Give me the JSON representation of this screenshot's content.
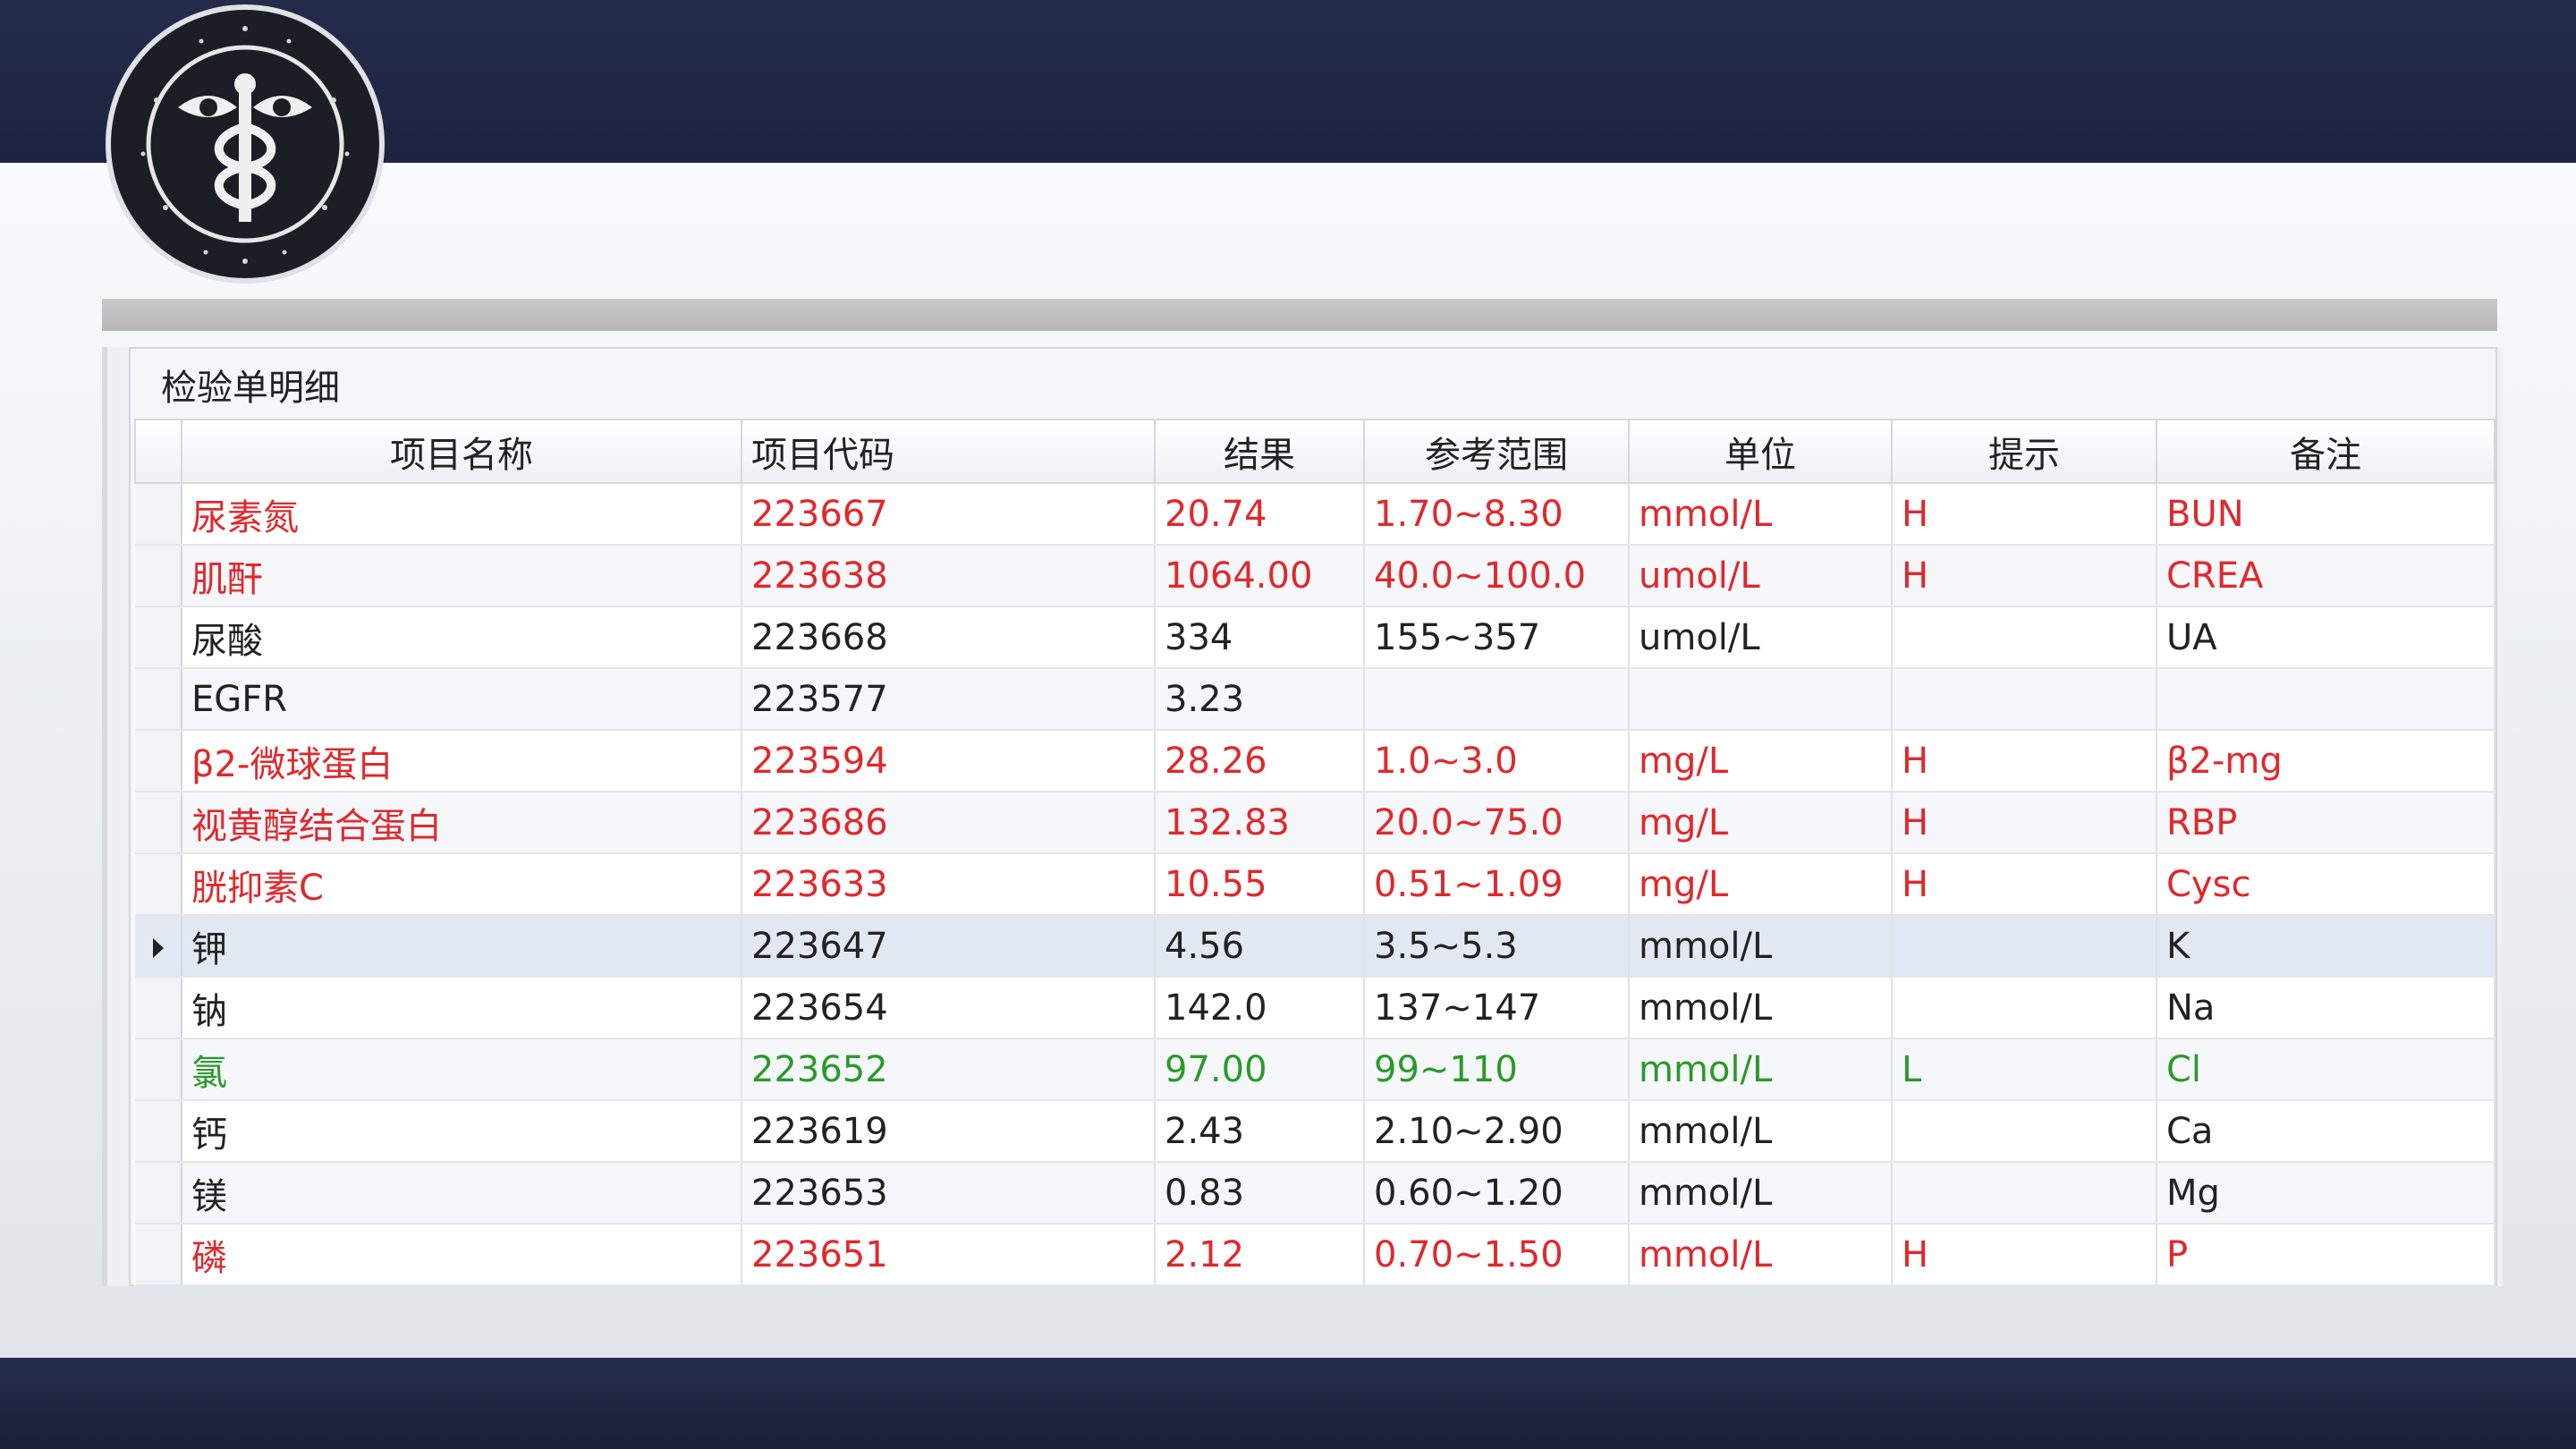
{
  "panel": {
    "title": "检验单明细"
  },
  "table": {
    "columns": [
      "项目名称",
      "项目代码",
      "结果",
      "参考范围",
      "单位",
      "提示",
      "备注"
    ],
    "rows": [
      {
        "name": "尿素氮",
        "code": "223667",
        "result": "20.74",
        "range": "1.70~8.30",
        "unit": "mmol/L",
        "flag": "H",
        "note": "BUN",
        "status": "high",
        "color": "#e0282c"
      },
      {
        "name": "肌酐",
        "code": "223638",
        "result": "1064.00",
        "range": "40.0~100.0",
        "unit": "umol/L",
        "flag": "H",
        "note": "CREA",
        "status": "high",
        "color": "#e0282c"
      },
      {
        "name": "尿酸",
        "code": "223668",
        "result": "334",
        "range": "155~357",
        "unit": "umol/L",
        "flag": "",
        "note": "UA",
        "status": "normal",
        "color": "#222222"
      },
      {
        "name": "EGFR",
        "code": "223577",
        "result": "3.23",
        "range": "",
        "unit": "",
        "flag": "",
        "note": "",
        "status": "normal",
        "color": "#222222"
      },
      {
        "name": "β2-微球蛋白",
        "code": "223594",
        "result": "28.26",
        "range": "1.0~3.0",
        "unit": "mg/L",
        "flag": "H",
        "note": "β2-mg",
        "status": "high",
        "color": "#e0282c"
      },
      {
        "name": "视黄醇结合蛋白",
        "code": "223686",
        "result": "132.83",
        "range": "20.0~75.0",
        "unit": "mg/L",
        "flag": "H",
        "note": "RBP",
        "status": "high",
        "color": "#e0282c"
      },
      {
        "name": "胱抑素C",
        "code": "223633",
        "result": "10.55",
        "range": "0.51~1.09",
        "unit": "mg/L",
        "flag": "H",
        "note": "Cysc",
        "status": "high",
        "color": "#e0282c"
      },
      {
        "name": "钾",
        "code": "223647",
        "result": "4.56",
        "range": "3.5~5.3",
        "unit": "mmol/L",
        "flag": "",
        "note": "K",
        "status": "normal",
        "color": "#222222",
        "selected": true
      },
      {
        "name": "钠",
        "code": "223654",
        "result": "142.0",
        "range": "137~147",
        "unit": "mmol/L",
        "flag": "",
        "note": "Na",
        "status": "normal",
        "color": "#222222"
      },
      {
        "name": "氯",
        "code": "223652",
        "result": "97.00",
        "range": "99~110",
        "unit": "mmol/L",
        "flag": "L",
        "note": "Cl",
        "status": "low",
        "color": "#2a9a2a"
      },
      {
        "name": "钙",
        "code": "223619",
        "result": "2.43",
        "range": "2.10~2.90",
        "unit": "mmol/L",
        "flag": "",
        "note": "Ca",
        "status": "normal",
        "color": "#222222"
      },
      {
        "name": "镁",
        "code": "223653",
        "result": "0.83",
        "range": "0.60~1.20",
        "unit": "mmol/L",
        "flag": "",
        "note": "Mg",
        "status": "normal",
        "color": "#222222"
      },
      {
        "name": "磷",
        "code": "223651",
        "result": "2.12",
        "range": "0.70~1.50",
        "unit": "mmol/L",
        "flag": "H",
        "note": "P",
        "status": "high",
        "color": "#e0282c"
      }
    ]
  }
}
